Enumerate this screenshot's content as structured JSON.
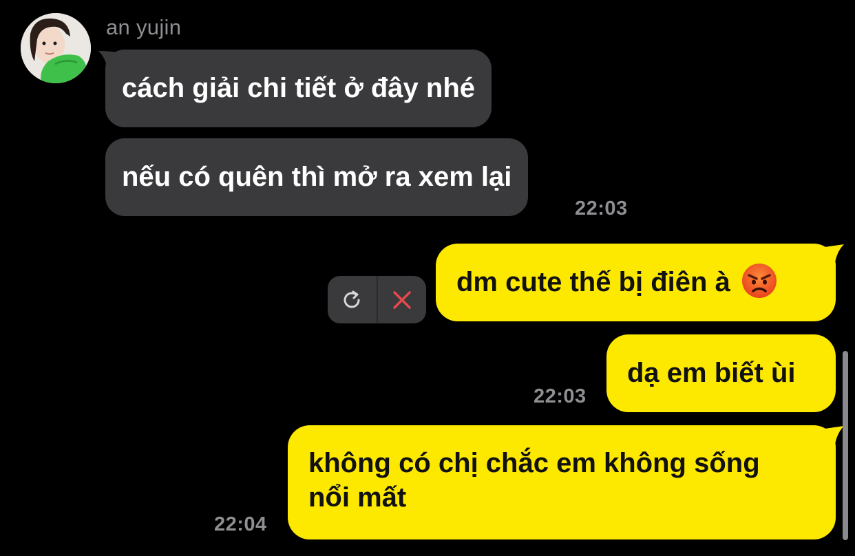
{
  "sender": {
    "name": "an yujin",
    "avatar_icon": "profile-photo"
  },
  "messages": {
    "incoming": [
      {
        "text": "cách giải chi tiết ở đây nhé"
      },
      {
        "text": "nếu có quên thì mở ra xem lại"
      }
    ],
    "incoming_time": "22:03",
    "outgoing": [
      {
        "text": "dm cute thế bị điên à",
        "emoji": "angry-face",
        "status": "failed"
      },
      {
        "text": "dạ em biết ùi",
        "time": "22:03"
      },
      {
        "line1": "không có chị chắc em không sống",
        "line2": "nổi mất",
        "time": "22:04"
      }
    ]
  },
  "failed_actions": {
    "retry_icon": "retry-icon",
    "delete_icon": "close-icon"
  },
  "colors": {
    "background": "#000000",
    "incoming_bubble": "#3a3a3c",
    "outgoing_bubble": "#fde800",
    "timestamp": "#8e8e93",
    "delete_x": "#e5484d"
  }
}
